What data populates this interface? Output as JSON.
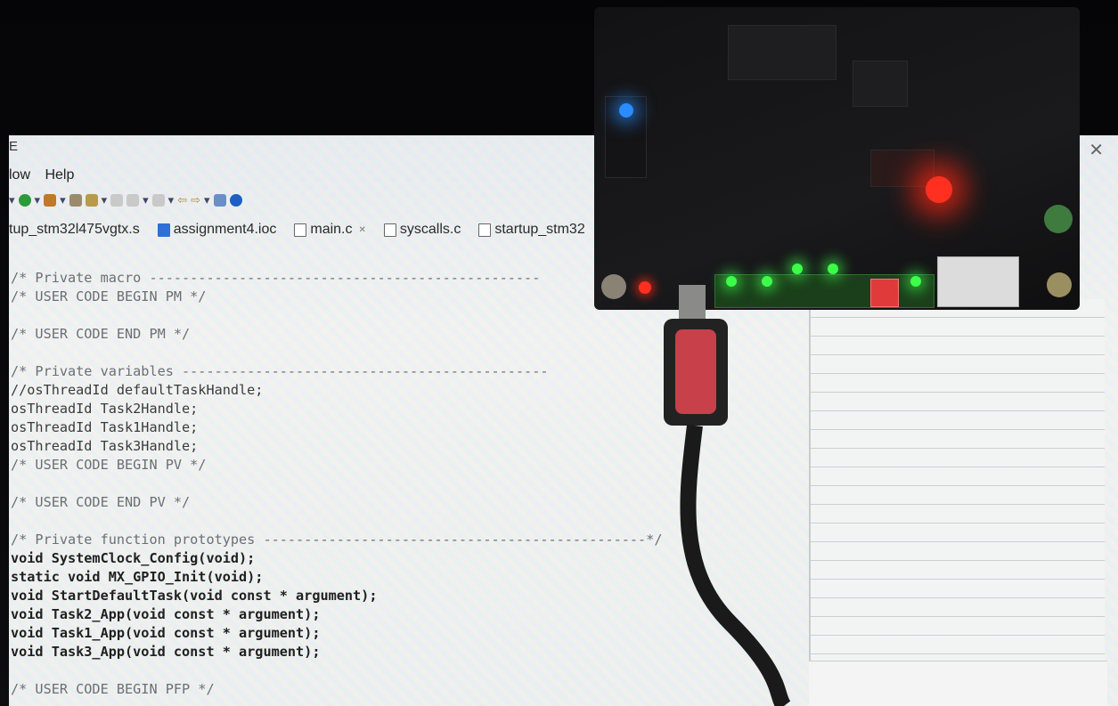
{
  "ide": {
    "title_fragment": "E",
    "menu": [
      "low",
      "Help"
    ],
    "tabs": [
      {
        "label": "tup_stm32l475vgtx.s",
        "icon": "file-icon"
      },
      {
        "label": "assignment4.ioc",
        "icon": "ioc-icon"
      },
      {
        "label": "main.c",
        "icon": "file-icon",
        "active": true
      },
      {
        "label": "syscalls.c",
        "icon": "file-icon"
      },
      {
        "label": "startup_stm32",
        "icon": "file-icon"
      }
    ],
    "code_lines": [
      {
        "text": "/* Private macro ------------------------------------------------",
        "kind": "cm"
      },
      {
        "text": "/* USER CODE BEGIN PM */",
        "kind": "cm"
      },
      {
        "text": "",
        "kind": "blank"
      },
      {
        "text": "/* USER CODE END PM */",
        "kind": "cm"
      },
      {
        "text": "",
        "kind": "blank"
      },
      {
        "text": "/* Private variables ---------------------------------------------",
        "kind": "cm"
      },
      {
        "text": "//osThreadId defaultTaskHandle;",
        "kind": "txt"
      },
      {
        "text": "osThreadId Task2Handle;",
        "kind": "txt"
      },
      {
        "text": "osThreadId Task1Handle;",
        "kind": "txt"
      },
      {
        "text": "osThreadId Task3Handle;",
        "kind": "txt"
      },
      {
        "text": "/* USER CODE BEGIN PV */",
        "kind": "cm"
      },
      {
        "text": "",
        "kind": "blank"
      },
      {
        "text": "/* USER CODE END PV */",
        "kind": "cm"
      },
      {
        "text": "",
        "kind": "blank"
      },
      {
        "text": "/* Private function prototypes -----------------------------------------------*/",
        "kind": "cm"
      },
      {
        "text": "void SystemClock_Config(void);",
        "kind": "kw"
      },
      {
        "text": "static void MX_GPIO_Init(void);",
        "kind": "kw"
      },
      {
        "text": "void StartDefaultTask(void const * argument);",
        "kind": "kw"
      },
      {
        "text": "void Task2_App(void const * argument);",
        "kind": "kw"
      },
      {
        "text": "void Task1_App(void const * argument);",
        "kind": "kw"
      },
      {
        "text": "void Task3_App(void const * argument);",
        "kind": "kw"
      },
      {
        "text": "",
        "kind": "blank"
      },
      {
        "text": "/* USER CODE BEGIN PFP */",
        "kind": "cm"
      }
    ]
  },
  "colors": {
    "led_red": "#ff3020",
    "led_green": "#3dff4a",
    "led_blue": "#2a8cff",
    "cable": "#1a1a1a",
    "connector_red": "#c8404a"
  }
}
